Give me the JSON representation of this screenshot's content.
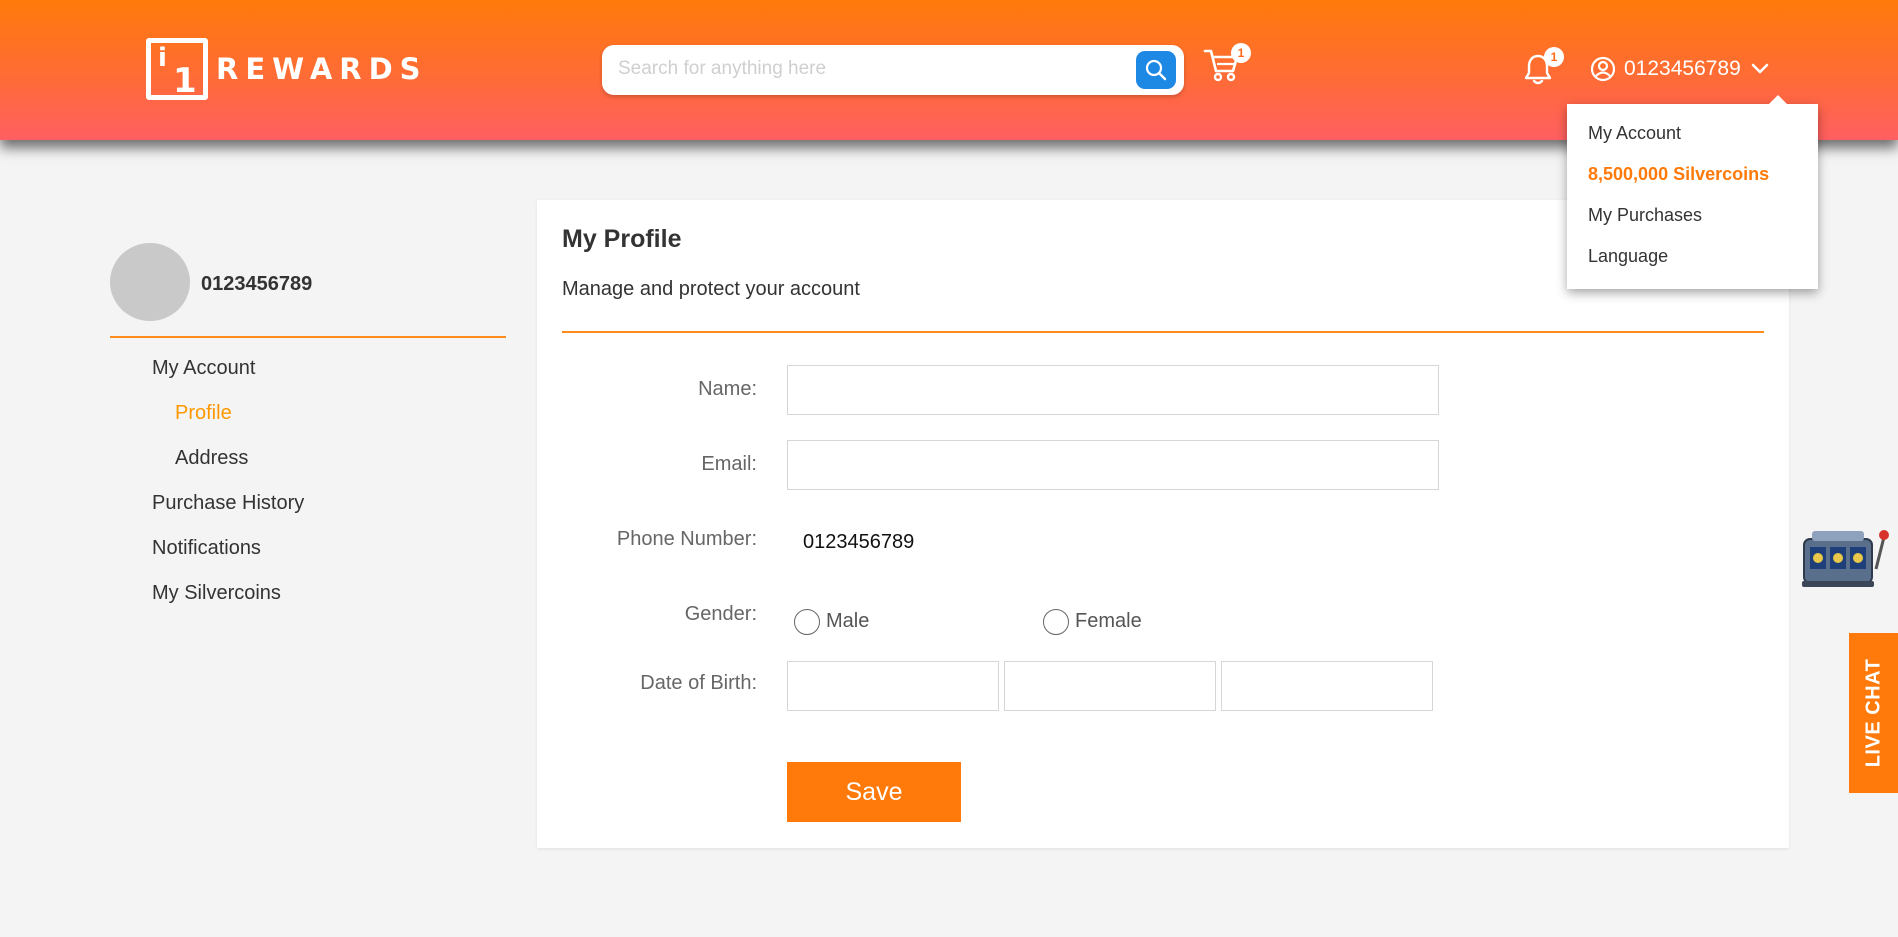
{
  "brand": {
    "logo_text": "REWARDS",
    "logo_mark": "i1"
  },
  "colors": {
    "accent": "#ff7a0a",
    "header_gradient_end": "#ff5f62",
    "search_button": "#1e88e5",
    "avatar": "#c9c9c9"
  },
  "header": {
    "search_placeholder": "Search for anything here",
    "cart_count": "1",
    "notification_count": "1",
    "username": "0123456789",
    "icons": [
      "search-icon",
      "cart-icon",
      "bell-icon",
      "user-circle-icon",
      "chevron-down-icon"
    ]
  },
  "dropdown": {
    "items": [
      "My Account",
      "8,500,000 Silvercoins",
      "My Purchases",
      "Language"
    ]
  },
  "sidebar": {
    "username": "0123456789",
    "items": [
      "My Account",
      "Profile",
      "Address",
      "Purchase History",
      "Notifications",
      "My Silvercoins"
    ],
    "active_item": "Profile"
  },
  "profile": {
    "title": "My Profile",
    "subtitle": "Manage and protect your account",
    "labels": {
      "name": "Name:",
      "email": "Email:",
      "phone": "Phone Number:",
      "gender": "Gender:",
      "dob": "Date of Birth:"
    },
    "values": {
      "name": "",
      "email": "",
      "phone": "0123456789"
    },
    "gender_options": [
      "Male",
      "Female"
    ],
    "save_label": "Save"
  },
  "live_chat": {
    "label": "LIVE CHAT"
  }
}
